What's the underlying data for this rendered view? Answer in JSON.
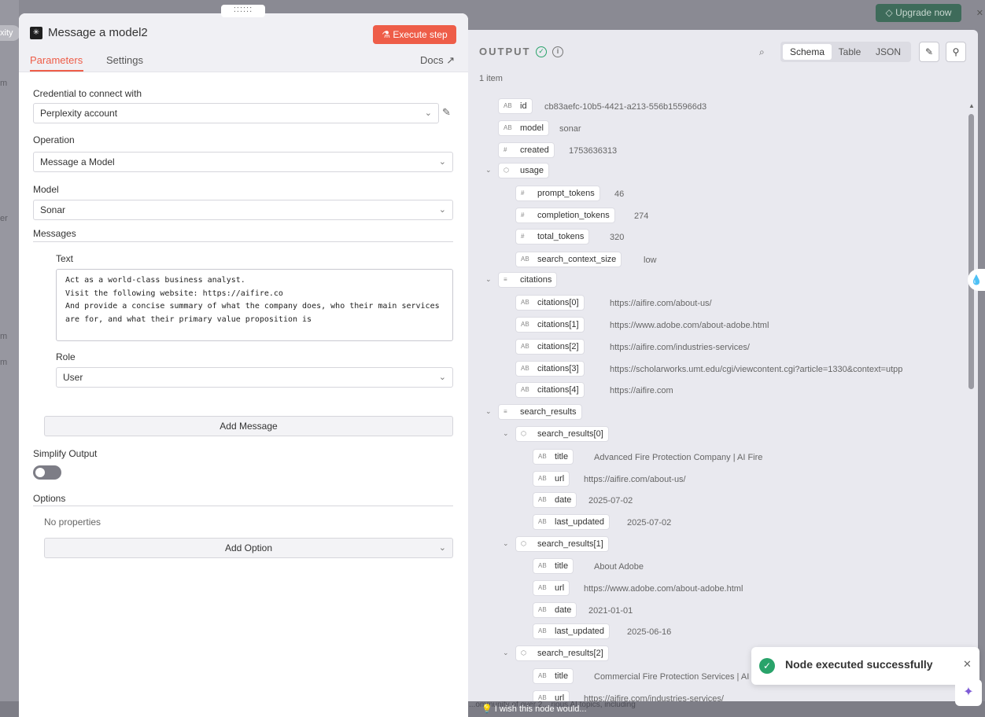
{
  "background": {
    "chip_text": "xity",
    "upgrade_label": "Upgrade now",
    "wish_text": "I wish this node would...",
    "bottom_fragment": "...ommunity of over 2... rious AI topics, including"
  },
  "node": {
    "title": "Message a model2",
    "execute_label": "Execute step",
    "tabs": [
      "Parameters",
      "Settings"
    ],
    "docs_label": "Docs"
  },
  "form": {
    "credential_label": "Credential to connect with",
    "credential_value": "Perplexity account",
    "operation_label": "Operation",
    "operation_value": "Message a Model",
    "model_label": "Model",
    "model_value": "Sonar",
    "messages_label": "Messages",
    "text_label": "Text",
    "text_value": "Act as a world-class business analyst.\nVisit the following website: https://aifire.co\nAnd provide a concise summary of what the company does, who their main services\nare for, and what their primary value proposition is",
    "role_label": "Role",
    "role_value": "User",
    "add_message_label": "Add Message",
    "simplify_label": "Simplify Output",
    "simplify_on": false,
    "options_label": "Options",
    "no_properties": "No properties",
    "add_option_label": "Add Option"
  },
  "output": {
    "title": "OUTPUT",
    "items_count": "1 item",
    "views": [
      "Schema",
      "Table",
      "JSON"
    ],
    "active_view": "Schema",
    "rows": [
      {
        "key": "id",
        "type": "AB",
        "value": "cb83aefc-10b5-4421-a213-556b155966d3"
      },
      {
        "key": "model",
        "type": "AB",
        "value": "sonar"
      },
      {
        "key": "created",
        "type": "#",
        "value": "1753636313"
      },
      {
        "key": "usage",
        "type": "obj",
        "value": ""
      },
      {
        "key": "prompt_tokens",
        "type": "#",
        "value": "46"
      },
      {
        "key": "completion_tokens",
        "type": "#",
        "value": "274"
      },
      {
        "key": "total_tokens",
        "type": "#",
        "value": "320"
      },
      {
        "key": "search_context_size",
        "type": "AB",
        "value": "low"
      },
      {
        "key": "citations",
        "type": "list",
        "value": ""
      },
      {
        "key": "citations[0]",
        "type": "AB",
        "value": "https://aifire.com/about-us/"
      },
      {
        "key": "citations[1]",
        "type": "AB",
        "value": "https://www.adobe.com/about-adobe.html"
      },
      {
        "key": "citations[2]",
        "type": "AB",
        "value": "https://aifire.com/industries-services/"
      },
      {
        "key": "citations[3]",
        "type": "AB",
        "value": "https://scholarworks.umt.edu/cgi/viewcontent.cgi?article=1330&context=utpp"
      },
      {
        "key": "citations[4]",
        "type": "AB",
        "value": "https://aifire.com"
      },
      {
        "key": "search_results",
        "type": "list",
        "value": ""
      },
      {
        "key": "search_results[0]",
        "type": "obj",
        "value": ""
      },
      {
        "key": "title",
        "type": "AB",
        "value": "Advanced Fire Protection Company | AI Fire"
      },
      {
        "key": "url",
        "type": "AB",
        "value": "https://aifire.com/about-us/"
      },
      {
        "key": "date",
        "type": "AB",
        "value": "2025-07-02"
      },
      {
        "key": "last_updated",
        "type": "AB",
        "value": "2025-07-02"
      },
      {
        "key": "search_results[1]",
        "type": "obj",
        "value": ""
      },
      {
        "key": "title",
        "type": "AB",
        "value": "About Adobe"
      },
      {
        "key": "url",
        "type": "AB",
        "value": "https://www.adobe.com/about-adobe.html"
      },
      {
        "key": "date",
        "type": "AB",
        "value": "2021-01-01"
      },
      {
        "key": "last_updated",
        "type": "AB",
        "value": "2025-06-16"
      },
      {
        "key": "search_results[2]",
        "type": "obj",
        "value": ""
      },
      {
        "key": "title",
        "type": "AB",
        "value": "Commercial Fire Protection Services | AI Fi"
      },
      {
        "key": "url",
        "type": "AB",
        "value": "https://aifire.com/industries-services/"
      }
    ]
  },
  "toast": {
    "message": "Node executed successfully"
  },
  "colors": {
    "accent": "#ee5d48",
    "success": "#29a36a",
    "ai": "#7e5bd6"
  }
}
